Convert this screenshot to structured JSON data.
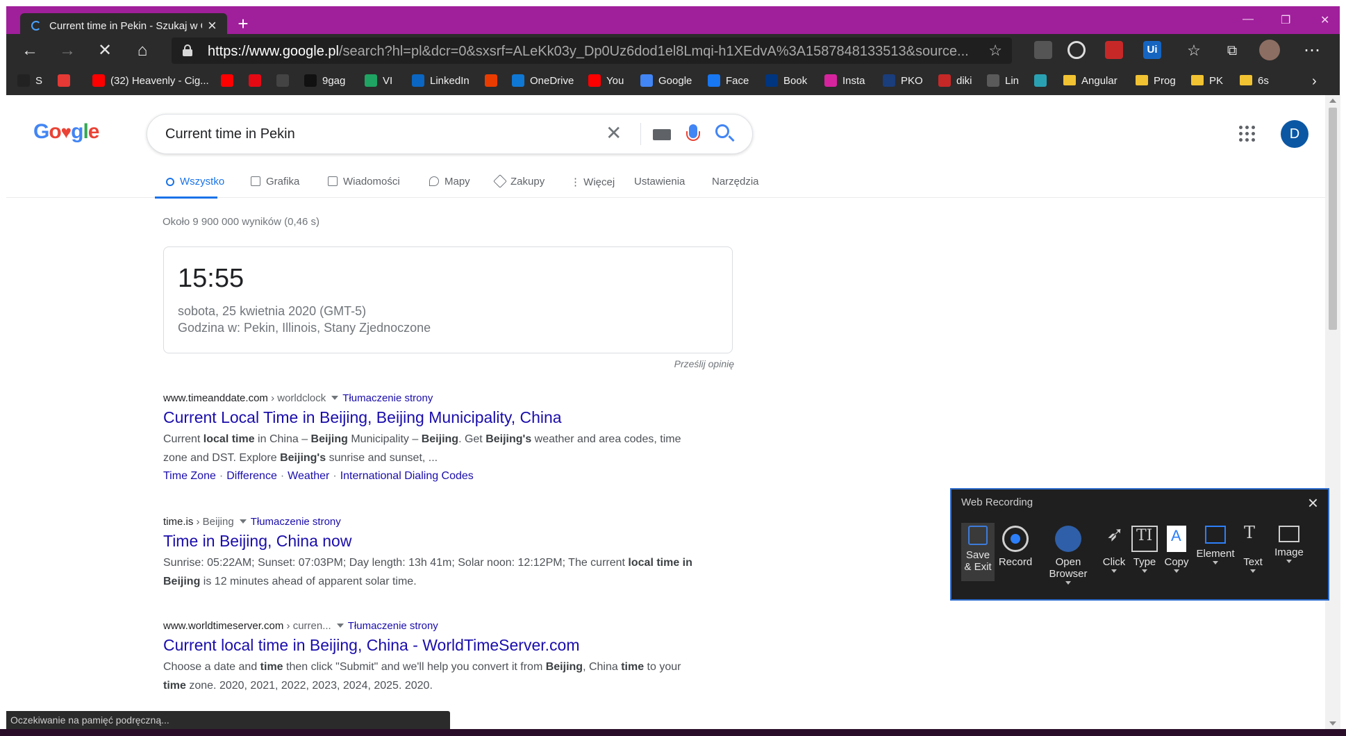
{
  "browser": {
    "tab_title": "Current time in Pekin - Szukaj w Google",
    "new_tab_label": "+",
    "window_controls": [
      "—",
      "❐",
      "✕"
    ],
    "url_host": "https://www.google.pl",
    "url_rest": "/search?hl=pl&dcr=0&sxsrf=ALeKk03y_Dp0Uz6dod1el8Lmqi-h1XEdvA%3A1587848133513&source...",
    "bookmarks": [
      {
        "label": "S",
        "color": "#222222"
      },
      {
        "label": "",
        "color": "#e53935"
      },
      {
        "label": "(32) Heavenly - Cig...",
        "color": "#ff0000"
      },
      {
        "label": "",
        "color": "#ff0000"
      },
      {
        "label": "",
        "color": "#e50914"
      },
      {
        "label": "",
        "color": "#444444"
      },
      {
        "label": "9gag",
        "color": "#111111"
      },
      {
        "label": "VI",
        "color": "#1fa463"
      },
      {
        "label": "LinkedIn",
        "color": "#0a66c2"
      },
      {
        "label": "",
        "color": "#eb3c00"
      },
      {
        "label": "OneDrive",
        "color": "#0f78d4"
      },
      {
        "label": "You",
        "color": "#ff0000"
      },
      {
        "label": "Google",
        "color": "#4285f4"
      },
      {
        "label": "Face",
        "color": "#1877f2"
      },
      {
        "label": "Book",
        "color": "#003580"
      },
      {
        "label": "Insta",
        "color": "#d6249f"
      },
      {
        "label": "PKO",
        "color": "#1a3d7c"
      },
      {
        "label": "diki",
        "color": "#c62828"
      },
      {
        "label": "Lin",
        "color": "#5a5a5a"
      },
      {
        "label": "",
        "color": "#2aa1b3"
      },
      {
        "label": "Angular",
        "color": "folder"
      },
      {
        "label": "Prog",
        "color": "folder"
      },
      {
        "label": "PK",
        "color": "folder"
      },
      {
        "label": "6s",
        "color": "folder"
      }
    ],
    "bookmarks_more": "›",
    "status_text": "Oczekiwanie na pamięć podręczną..."
  },
  "google": {
    "logo_letters": [
      {
        "ch": "G",
        "color": "#4285f4"
      },
      {
        "ch": "o",
        "color": "#ea4335"
      },
      {
        "ch": "♥",
        "color": "#ea4335"
      },
      {
        "ch": "g",
        "color": "#4285f4"
      },
      {
        "ch": "l",
        "color": "#34a853"
      },
      {
        "ch": "e",
        "color": "#ea4335"
      }
    ],
    "query": "Current time in Pekin",
    "avatar_letter": "D",
    "tabs": [
      "Wszystko",
      "Grafika",
      "Wiadomości",
      "Mapy",
      "Zakupy",
      "⋮ Więcej",
      "Ustawienia",
      "Narzędzia"
    ],
    "result_stats": "Około 9 900 000 wyników (0,46 s)",
    "time_card": {
      "time": "15:55",
      "date": "sobota, 25 kwietnia 2020 (GMT-5)",
      "location": "Godzina w: Pekin, Illinois, Stany Zjednoczone"
    },
    "feedback": "Prześlij opinię",
    "translate_label": "Tłumaczenie strony",
    "results": [
      {
        "host": "www.timeanddate.com",
        "path": " › worldclock",
        "title": "Current Local Time in Beijing, Beijing Municipality, China",
        "snippet_html": "Current <b>local time</b> in China – <b>Beijing</b> Municipality – <b>Beijing</b>. Get <b>Beijing's</b> weather and area codes, time zone and DST. Explore <b>Beijing's</b> sunrise and sunset, ...",
        "links": [
          "Time Zone",
          "Difference",
          "Weather",
          "International Dialing Codes"
        ]
      },
      {
        "host": "time.is",
        "path": " › Beijing",
        "title": "Time in Beijing, China now",
        "snippet_html": "Sunrise: 05:22AM; Sunset: 07:03PM; Day length: 13h 41m; Solar noon: 12:12PM; The current <b>local time in Beijing</b> is 12 minutes ahead of apparent solar time.",
        "links": []
      },
      {
        "host": "www.worldtimeserver.com",
        "path": " › curren...",
        "title": "Current local time in Beijing, China - WorldTimeServer.com",
        "snippet_html": "Choose a date and <b>time</b> then click \"Submit\" and we'll help you convert it from <b>Beijing</b>, China <b>time</b> to your <b>time</b> zone. 2020, 2021, 2022, 2023, 2024, 2025. 2020.",
        "links": []
      }
    ]
  },
  "web_recording": {
    "title": "Web Recording",
    "buttons": [
      {
        "label": "Save & Exit",
        "caret": false
      },
      {
        "label": "Record",
        "caret": false
      },
      {
        "label": "Open Browser",
        "caret": true
      },
      {
        "label": "Click",
        "caret": true
      },
      {
        "label": "Type",
        "caret": true
      },
      {
        "label": "Copy",
        "caret": true
      },
      {
        "label": "Element",
        "caret": true
      },
      {
        "label": "Text",
        "caret": true
      },
      {
        "label": "Image",
        "caret": true
      }
    ]
  },
  "colors": {
    "titlebar": "#a01f9b",
    "chrome_dark": "#2b2b2b",
    "link_blue": "#1a0dab",
    "accent_blue": "#1a73e8",
    "recorder_border": "#2c6bcc"
  }
}
